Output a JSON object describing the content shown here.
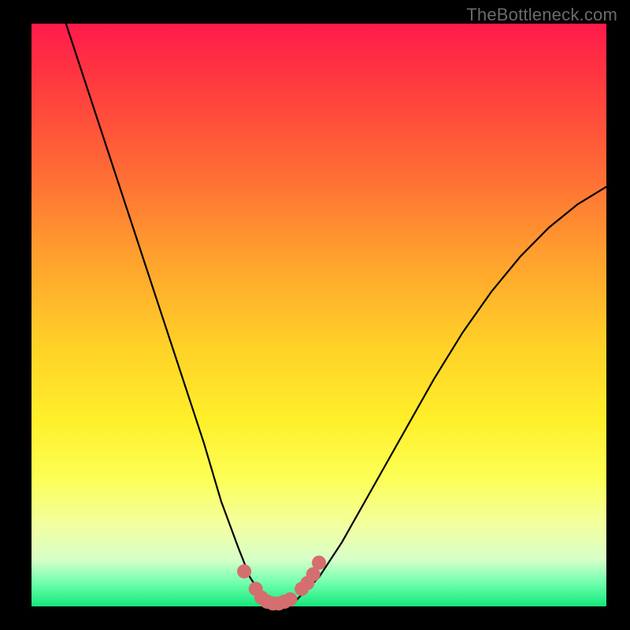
{
  "watermark": "TheBottleneck.com",
  "chart_data": {
    "type": "line",
    "title": "",
    "xlabel": "",
    "ylabel": "",
    "xlim": [
      0,
      100
    ],
    "ylim": [
      0,
      100
    ],
    "grid": false,
    "legend": false,
    "series": [
      {
        "name": "bottleneck-curve",
        "color": "#000000",
        "x": [
          6,
          10,
          14,
          18,
          22,
          26,
          30,
          33,
          36,
          38,
          40,
          42,
          44,
          46,
          50,
          54,
          58,
          62,
          66,
          70,
          75,
          80,
          85,
          90,
          95,
          100
        ],
        "values": [
          100,
          88,
          76,
          64,
          52,
          40,
          28,
          18,
          10,
          5,
          2,
          0,
          0,
          1,
          5,
          11,
          18,
          25,
          32,
          39,
          47,
          54,
          60,
          65,
          69,
          72
        ]
      }
    ],
    "markers": [
      {
        "name": "highlight-dots",
        "color": "#d56e6e",
        "radius_px": 9,
        "x": [
          37,
          39,
          40,
          41,
          42,
          43,
          44,
          45,
          47,
          48,
          49,
          50
        ],
        "values": [
          6,
          3,
          1.5,
          0.8,
          0.5,
          0.5,
          0.8,
          1.2,
          3,
          4,
          5.5,
          7.5
        ]
      }
    ],
    "gradient_stops": [
      {
        "pos": 0.0,
        "color": "#ff1a4b"
      },
      {
        "pos": 0.1,
        "color": "#ff3a3f"
      },
      {
        "pos": 0.25,
        "color": "#ff6a36"
      },
      {
        "pos": 0.4,
        "color": "#ffa02e"
      },
      {
        "pos": 0.55,
        "color": "#ffd028"
      },
      {
        "pos": 0.68,
        "color": "#ffef2a"
      },
      {
        "pos": 0.78,
        "color": "#fcff55"
      },
      {
        "pos": 0.86,
        "color": "#f3ffa0"
      },
      {
        "pos": 0.92,
        "color": "#d6ffc8"
      },
      {
        "pos": 0.96,
        "color": "#6fffad"
      },
      {
        "pos": 1.0,
        "color": "#14e87a"
      }
    ]
  }
}
